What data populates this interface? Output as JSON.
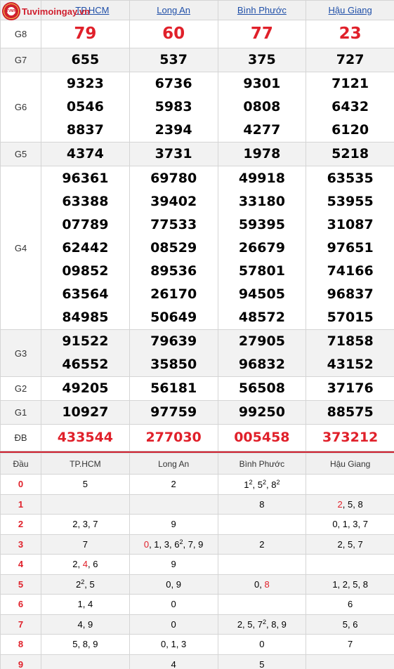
{
  "logo": {
    "badge_text": "TVMN",
    "site_name": "Tuvimoingay.vn"
  },
  "provinces": [
    "TP.HCM",
    "Long An",
    "Bình Phước",
    "Hậu Giang"
  ],
  "prizes": [
    {
      "label": "G8",
      "values": [
        [
          "79"
        ],
        [
          "60"
        ],
        [
          "77"
        ],
        [
          "23"
        ]
      ]
    },
    {
      "label": "G7",
      "values": [
        [
          "655"
        ],
        [
          "537"
        ],
        [
          "375"
        ],
        [
          "727"
        ]
      ]
    },
    {
      "label": "G6",
      "values": [
        [
          "9323",
          "0546",
          "8837"
        ],
        [
          "6736",
          "5983",
          "2394"
        ],
        [
          "9301",
          "0808",
          "4277"
        ],
        [
          "7121",
          "6432",
          "6120"
        ]
      ]
    },
    {
      "label": "G5",
      "values": [
        [
          "4374"
        ],
        [
          "3731"
        ],
        [
          "1978"
        ],
        [
          "5218"
        ]
      ]
    },
    {
      "label": "G4",
      "values": [
        [
          "96361",
          "63388",
          "07789",
          "62442",
          "09852",
          "63564",
          "84985"
        ],
        [
          "69780",
          "39402",
          "77533",
          "08529",
          "89536",
          "26170",
          "50649"
        ],
        [
          "49918",
          "33180",
          "59395",
          "26679",
          "57801",
          "94505",
          "48572"
        ],
        [
          "63535",
          "53955",
          "31087",
          "97651",
          "74166",
          "96837",
          "57015"
        ]
      ]
    },
    {
      "label": "G3",
      "values": [
        [
          "91522",
          "46552"
        ],
        [
          "79639",
          "35850"
        ],
        [
          "27905",
          "96832"
        ],
        [
          "71858",
          "43152"
        ]
      ]
    },
    {
      "label": "G2",
      "values": [
        [
          "49205"
        ],
        [
          "56181"
        ],
        [
          "56508"
        ],
        [
          "37176"
        ]
      ]
    },
    {
      "label": "G1",
      "values": [
        [
          "10927"
        ],
        [
          "97759"
        ],
        [
          "99250"
        ],
        [
          "88575"
        ]
      ]
    },
    {
      "label": "ĐB",
      "values": [
        [
          "433544"
        ],
        [
          "277030"
        ],
        [
          "005458"
        ],
        [
          "373212"
        ]
      ]
    }
  ],
  "dau_table": {
    "header": "Đầu",
    "rows": [
      {
        "digit": "0",
        "cells": [
          [
            {
              "t": "5"
            }
          ],
          [
            {
              "t": "2"
            }
          ],
          [
            {
              "t": "1",
              "s": "2"
            },
            {
              "t": ", 5",
              "s": "2"
            },
            {
              "t": ", 8",
              "s": "2"
            }
          ],
          []
        ]
      },
      {
        "digit": "1",
        "cells": [
          [],
          [],
          [
            {
              "t": "8"
            }
          ],
          [
            {
              "t": "2",
              "red": true
            },
            {
              "t": ", 5, 8"
            }
          ]
        ]
      },
      {
        "digit": "2",
        "cells": [
          [
            {
              "t": "2, 3, 7"
            }
          ],
          [
            {
              "t": "9"
            }
          ],
          [],
          [
            {
              "t": "0, 1, 3, 7"
            }
          ]
        ]
      },
      {
        "digit": "3",
        "cells": [
          [
            {
              "t": "7"
            }
          ],
          [
            {
              "t": "0",
              "red": true
            },
            {
              "t": ", 1, 3, 6",
              "s": "2"
            },
            {
              "t": ", 7, 9"
            }
          ],
          [
            {
              "t": "2"
            }
          ],
          [
            {
              "t": "2, 5, 7"
            }
          ]
        ]
      },
      {
        "digit": "4",
        "cells": [
          [
            {
              "t": "2, "
            },
            {
              "t": "4",
              "red": true
            },
            {
              "t": ", 6"
            }
          ],
          [
            {
              "t": "9"
            }
          ],
          [],
          []
        ]
      },
      {
        "digit": "5",
        "cells": [
          [
            {
              "t": "2",
              "s": "2"
            },
            {
              "t": ", 5"
            }
          ],
          [
            {
              "t": "0, 9"
            }
          ],
          [
            {
              "t": "0, "
            },
            {
              "t": "8",
              "red": true
            }
          ],
          [
            {
              "t": "1, 2, 5, 8"
            }
          ]
        ]
      },
      {
        "digit": "6",
        "cells": [
          [
            {
              "t": "1, 4"
            }
          ],
          [
            {
              "t": "0"
            }
          ],
          [],
          [
            {
              "t": "6"
            }
          ]
        ]
      },
      {
        "digit": "7",
        "cells": [
          [
            {
              "t": "4, 9"
            }
          ],
          [
            {
              "t": "0"
            }
          ],
          [
            {
              "t": "2, 5, 7",
              "s": "2"
            },
            {
              "t": ", 8, 9"
            }
          ],
          [
            {
              "t": "5, 6"
            }
          ]
        ]
      },
      {
        "digit": "8",
        "cells": [
          [
            {
              "t": "5, 8, 9"
            }
          ],
          [
            {
              "t": "0, 1, 3"
            }
          ],
          [
            {
              "t": "0"
            }
          ],
          [
            {
              "t": "7"
            }
          ]
        ]
      },
      {
        "digit": "9",
        "cells": [
          [],
          [
            {
              "t": "4"
            }
          ],
          [
            {
              "t": "5"
            }
          ],
          []
        ]
      }
    ]
  },
  "colors": {
    "accent_red": "#e0202a",
    "link_blue": "#1f4fa8",
    "row_alt": "#f2f2f2"
  }
}
